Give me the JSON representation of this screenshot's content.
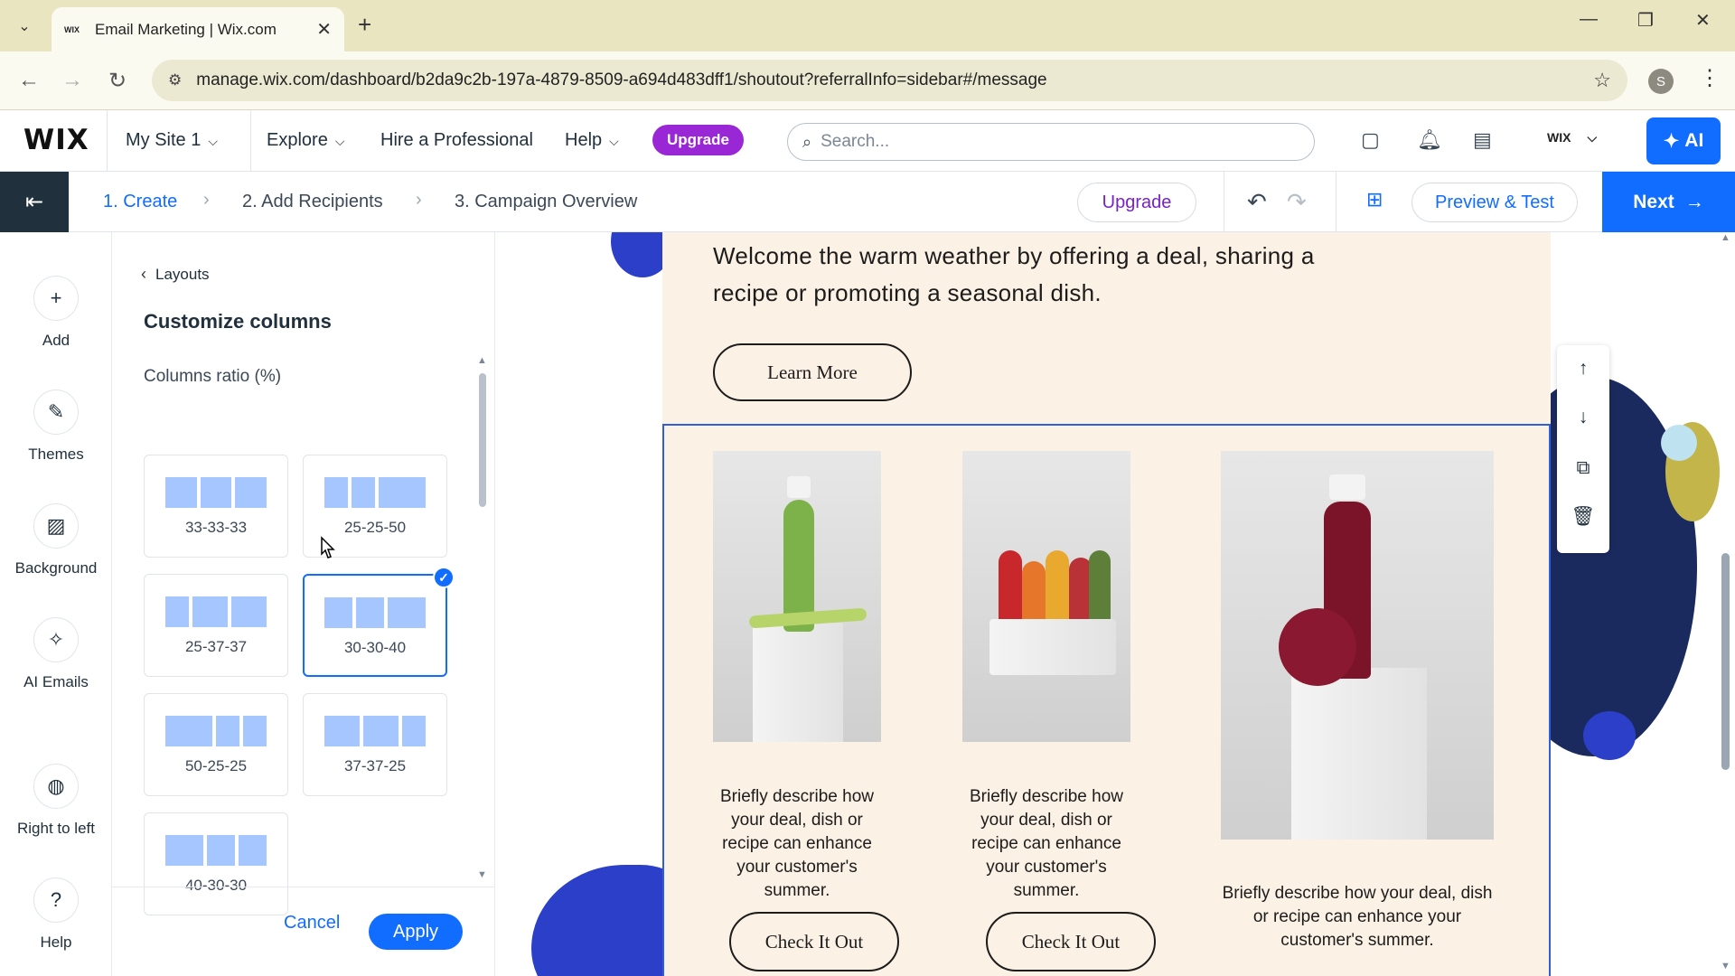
{
  "browser": {
    "tab_title": "Email Marketing | Wix.com",
    "tab_favicon": "WIX",
    "url": "manage.wix.com/dashboard/b2da9c2b-197a-4879-8509-a694d483dff1/shoutout?referralInfo=sidebar#/message",
    "profile_initial": "S"
  },
  "wix_header": {
    "logo": "WIX",
    "site_selector": "My Site 1",
    "explore": "Explore",
    "hire": "Hire a Professional",
    "help": "Help",
    "upgrade": "Upgrade",
    "search_placeholder": "Search...",
    "account": "WIX",
    "ai": "AI"
  },
  "steps": {
    "step1": "1. Create",
    "step2": "2. Add Recipients",
    "step3": "3. Campaign Overview",
    "upgrade": "Upgrade",
    "preview": "Preview & Test",
    "next": "Next"
  },
  "rail": {
    "add": "Add",
    "themes": "Themes",
    "background": "Background",
    "ai_emails": "AI Emails",
    "rtl": "Right to left",
    "help": "Help"
  },
  "panel": {
    "back": "Layouts",
    "title": "Customize columns",
    "ratio_label": "Columns ratio (%)",
    "options": [
      {
        "label": "33-33-33",
        "ratios": [
          33,
          33,
          33
        ],
        "selected": false
      },
      {
        "label": "25-25-50",
        "ratios": [
          25,
          25,
          50
        ],
        "selected": false
      },
      {
        "label": "25-37-37",
        "ratios": [
          25,
          37,
          37
        ],
        "selected": false
      },
      {
        "label": "30-30-40",
        "ratios": [
          30,
          30,
          40
        ],
        "selected": true
      },
      {
        "label": "50-25-25",
        "ratios": [
          50,
          25,
          25
        ],
        "selected": false
      },
      {
        "label": "37-37-25",
        "ratios": [
          37,
          37,
          25
        ],
        "selected": false
      },
      {
        "label": "40-30-30",
        "ratios": [
          40,
          30,
          30
        ],
        "selected": false
      }
    ],
    "cancel": "Cancel",
    "apply": "Apply"
  },
  "email": {
    "intro": "Welcome the warm weather by offering a deal, sharing a recipe or promoting a seasonal dish.",
    "learn_more": "Learn More",
    "col1_text": "Briefly describe how your deal, dish or recipe can enhance your customer's summer.",
    "col2_text": "Briefly describe how your deal, dish or recipe can enhance your customer's summer.",
    "col3_text": "Briefly describe how your deal, dish or recipe can enhance your customer's summer.",
    "check_out": "Check It Out"
  },
  "colors": {
    "accent": "#116dff",
    "upgrade_purple": "#9a27d5",
    "email_bg": "#fbf1e4",
    "blob_blue": "#2c3fc9",
    "blob_navy": "#1b2a5e",
    "blob_olive": "#c3b54a"
  }
}
